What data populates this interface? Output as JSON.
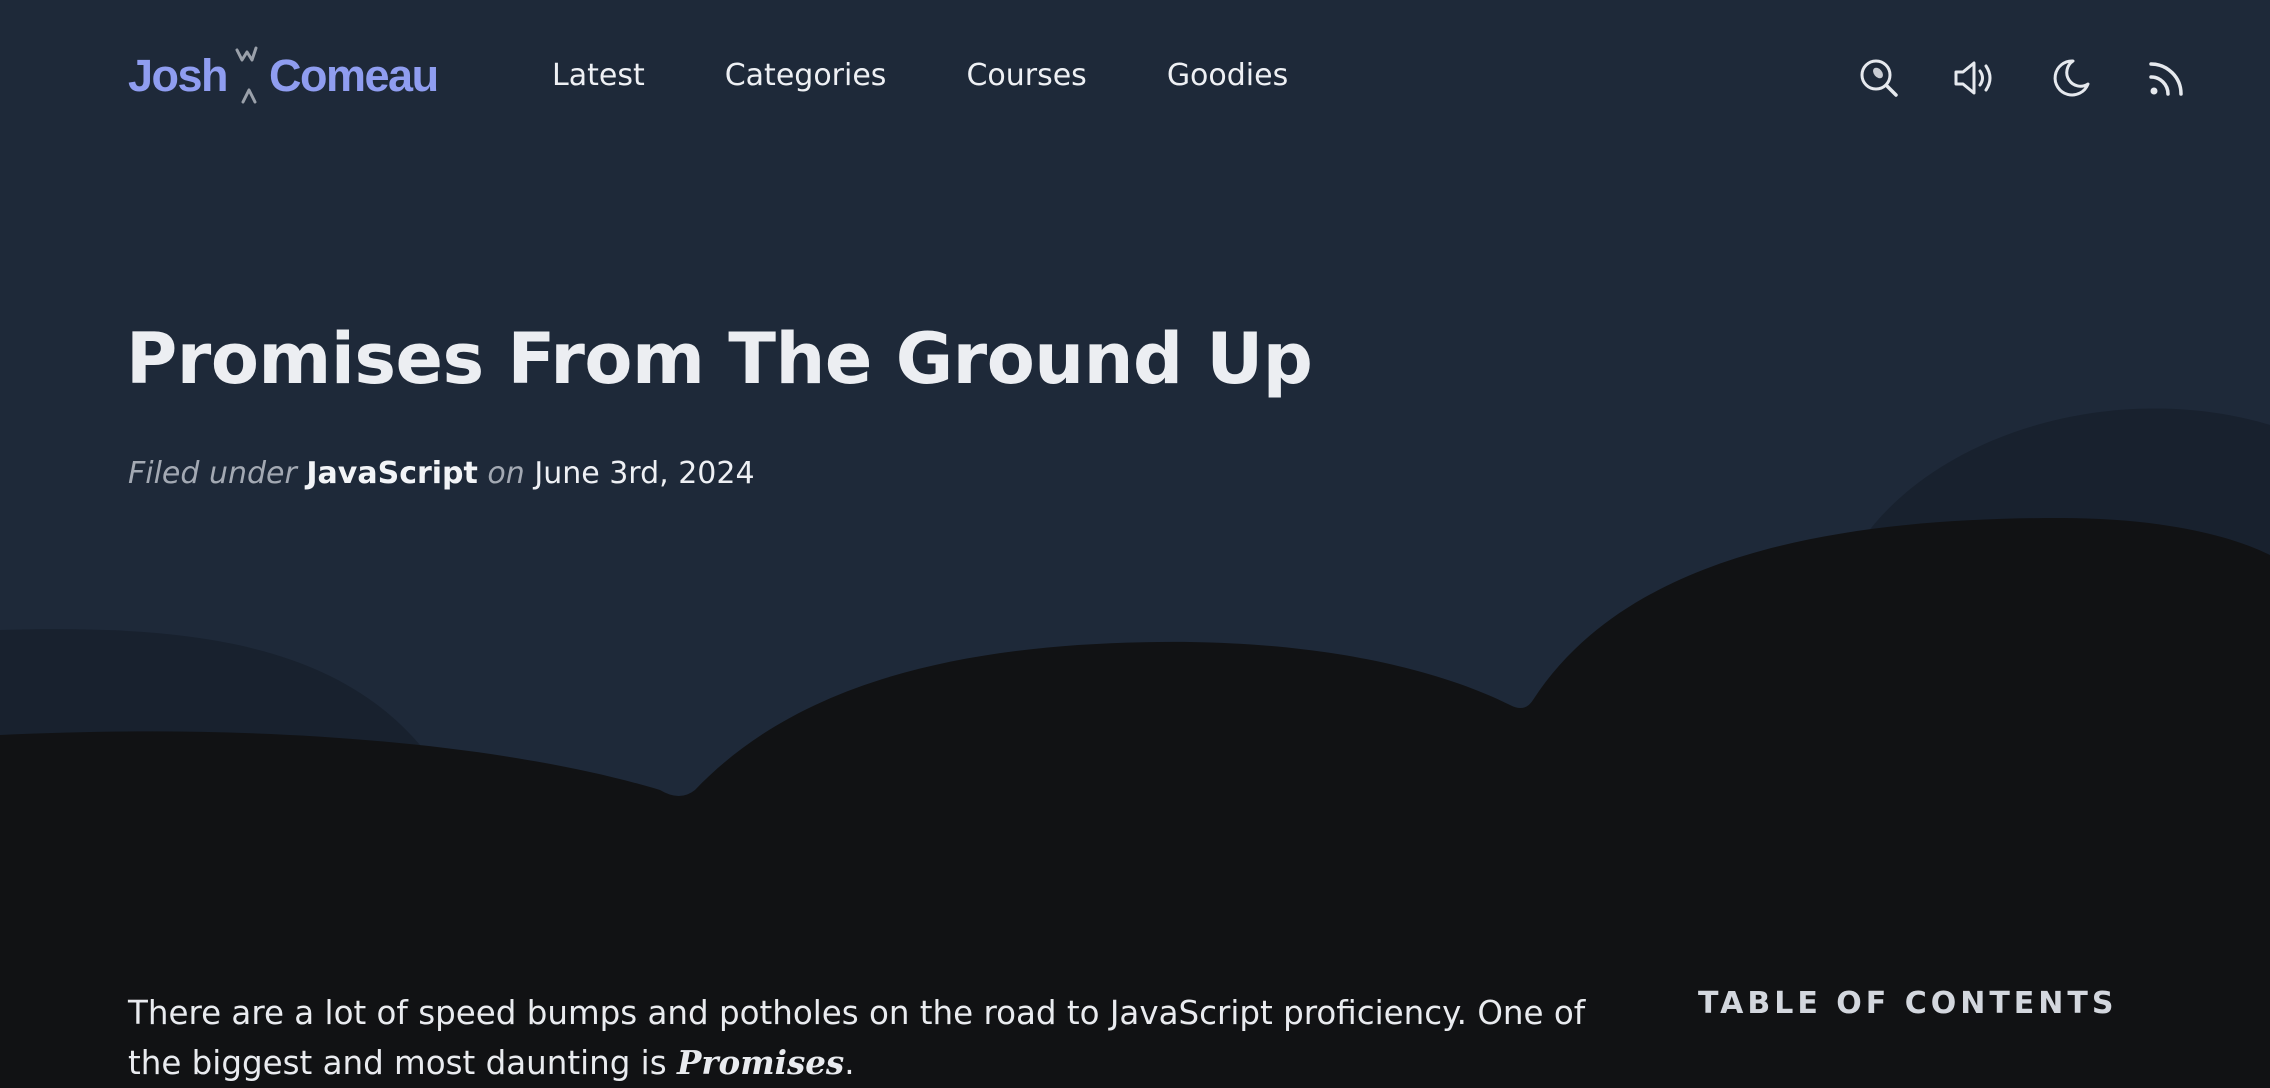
{
  "site": {
    "logo_first": "Josh",
    "logo_last": "Comeau",
    "brand_color": "#8f9df0"
  },
  "nav": {
    "items": [
      {
        "label": "Latest"
      },
      {
        "label": "Categories"
      },
      {
        "label": "Courses"
      },
      {
        "label": "Goodies"
      }
    ]
  },
  "actions": {
    "icons": [
      "search-icon",
      "sound-icon",
      "moon-icon",
      "rss-icon"
    ]
  },
  "article": {
    "title": "Promises From The Ground Up",
    "filed_under": "Filed under",
    "category": "JavaScript",
    "on": "on",
    "date": "June 3rd, 2024",
    "intro_text": "There are a lot of speed bumps and potholes on the road to JavaScript proficiency. One of the biggest and most daunting is ",
    "intro_emphasis": "Promises",
    "intro_end": "."
  },
  "toc": {
    "title": "TABLE OF CONTENTS"
  },
  "colors": {
    "header_bg": "#1e2939",
    "hill_far": "#18212e",
    "page_bg": "#111214",
    "text": "#eceef2"
  }
}
